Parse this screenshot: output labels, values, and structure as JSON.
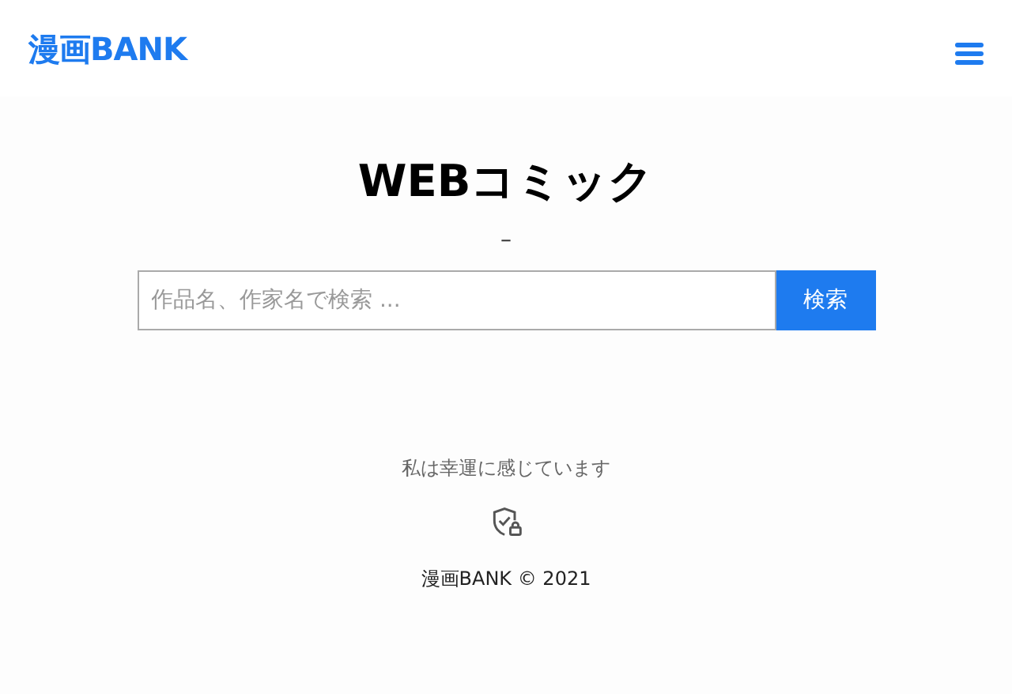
{
  "header": {
    "logo": "漫画BANK"
  },
  "main": {
    "title": "WEBコミック",
    "divider": "–",
    "search": {
      "placeholder": "作品名、作家名で検索 ...",
      "button": "検索"
    }
  },
  "footer": {
    "lucky": "私は幸運に感じています",
    "copyright": "漫画BANK © 2021"
  }
}
